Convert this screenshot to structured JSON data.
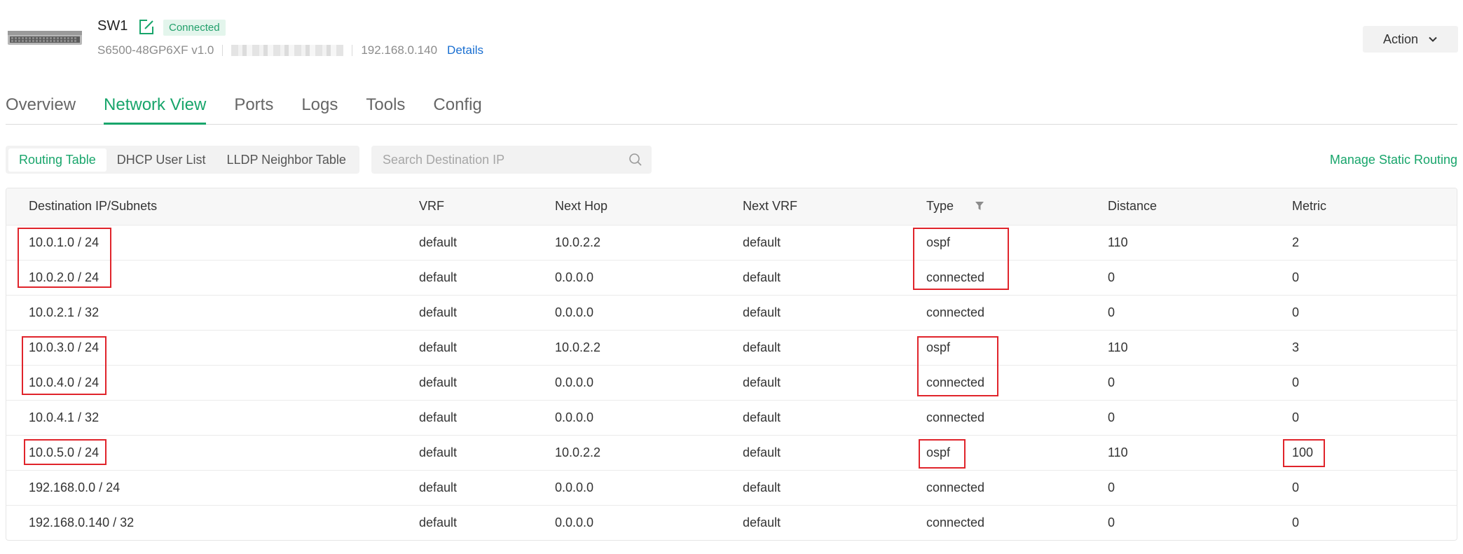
{
  "device": {
    "name": "SW1",
    "status": "Connected",
    "model": "S6500-48GP6XF v1.0",
    "ip": "192.168.0.140",
    "details_label": "Details",
    "action_label": "Action"
  },
  "main_tabs": [
    {
      "label": "Overview",
      "active": false
    },
    {
      "label": "Network View",
      "active": true
    },
    {
      "label": "Ports",
      "active": false
    },
    {
      "label": "Logs",
      "active": false
    },
    {
      "label": "Tools",
      "active": false
    },
    {
      "label": "Config",
      "active": false
    }
  ],
  "sub_tabs": [
    {
      "label": "Routing Table",
      "active": true
    },
    {
      "label": "DHCP User List",
      "active": false
    },
    {
      "label": "LLDP Neighbor Table",
      "active": false
    }
  ],
  "search": {
    "placeholder": "Search Destination IP",
    "value": ""
  },
  "manage_static_routing_label": "Manage Static Routing",
  "table": {
    "headers": {
      "destination": "Destination IP/Subnets",
      "vrf": "VRF",
      "next_hop": "Next Hop",
      "next_vrf": "Next VRF",
      "type": "Type",
      "distance": "Distance",
      "metric": "Metric"
    },
    "rows": [
      [
        "10.0.1.0 / 24",
        "default",
        "10.0.2.2",
        "default",
        "ospf",
        "110",
        "2"
      ],
      [
        "10.0.2.0 / 24",
        "default",
        "0.0.0.0",
        "default",
        "connected",
        "0",
        "0"
      ],
      [
        "10.0.2.1 / 32",
        "default",
        "0.0.0.0",
        "default",
        "connected",
        "0",
        "0"
      ],
      [
        "10.0.3.0 / 24",
        "default",
        "10.0.2.2",
        "default",
        "ospf",
        "110",
        "3"
      ],
      [
        "10.0.4.0 / 24",
        "default",
        "0.0.0.0",
        "default",
        "connected",
        "0",
        "0"
      ],
      [
        "10.0.4.1 / 32",
        "default",
        "0.0.0.0",
        "default",
        "connected",
        "0",
        "0"
      ],
      [
        "10.0.5.0 / 24",
        "default",
        "10.0.2.2",
        "default",
        "ospf",
        "110",
        "100"
      ],
      [
        "192.168.0.0 / 24",
        "default",
        "0.0.0.0",
        "default",
        "connected",
        "0",
        "0"
      ],
      [
        "192.168.0.140 / 32",
        "default",
        "0.0.0.0",
        "default",
        "connected",
        "0",
        "0"
      ]
    ]
  },
  "colors": {
    "accent": "#18a56b",
    "link": "#1a6fd1",
    "annotation": "#e0242b"
  }
}
